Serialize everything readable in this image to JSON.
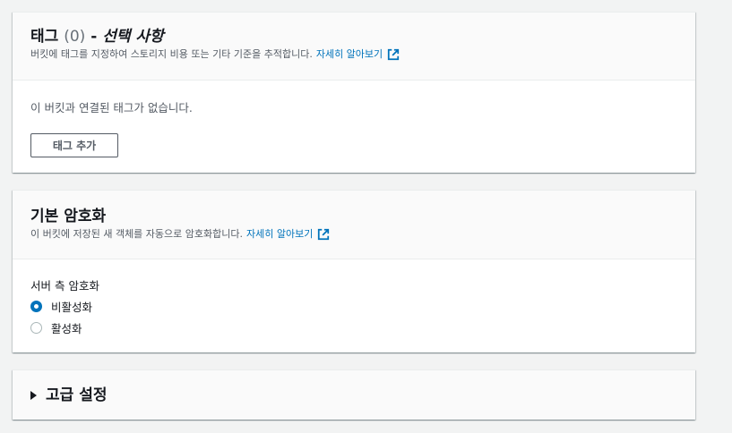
{
  "tags": {
    "title": "태그",
    "count": "(0)",
    "separator": "-",
    "optional": "선택 사항",
    "description": "버킷에 태그를 지정하여 스토리지 비용 또는 기타 기준을 추적합니다.",
    "learn_more": "자세히 알아보기",
    "empty_text": "이 버킷과 연결된 태그가 없습니다.",
    "add_tag_label": "태그 추가"
  },
  "encryption": {
    "title": "기본 암호화",
    "description": "이 버킷에 저장된 새 객체를 자동으로 암호화합니다.",
    "learn_more": "자세히 알아보기",
    "field_label": "서버 측 암호화",
    "options": [
      {
        "label": "비활성화",
        "checked": true
      },
      {
        "label": "활성화",
        "checked": false
      }
    ]
  },
  "advanced": {
    "title": "고급 설정",
    "expanded": false
  },
  "colors": {
    "link": "#0073bb",
    "radio_selected": "#0073bb",
    "page_bg": "#f2f3f3"
  },
  "icons": {
    "external_link": "external-link-icon",
    "caret": "caret-right-icon"
  }
}
